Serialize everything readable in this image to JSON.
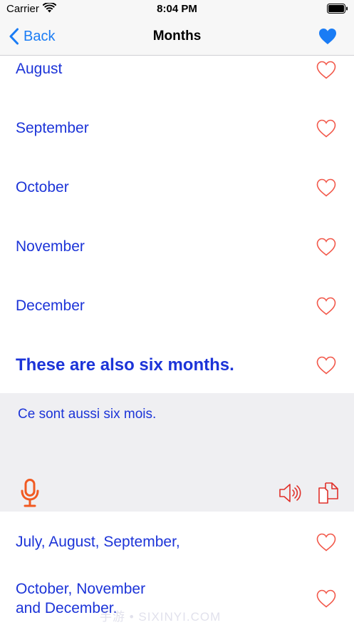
{
  "status_bar": {
    "carrier": "Carrier",
    "time": "8:04 PM"
  },
  "nav": {
    "back_label": "Back",
    "title": "Months"
  },
  "colors": {
    "accent": "#1a7cf5",
    "text_blue": "#1c34d8",
    "heart_outline": "#f2584a",
    "mic": "#f15a22",
    "speaker": "#e0302a",
    "panel_bg": "#efeff2"
  },
  "rows": [
    {
      "label": "August"
    },
    {
      "label": "September"
    },
    {
      "label": "October"
    },
    {
      "label": "November"
    },
    {
      "label": "December"
    },
    {
      "label": "These are also six months."
    }
  ],
  "panel": {
    "translation": "Ce sont aussi six mois."
  },
  "lower_rows": [
    {
      "label": "July, August, September,"
    },
    {
      "line1": "October, November",
      "line2": "and December."
    }
  ],
  "watermark": "手游 • SIXINYI.COM"
}
